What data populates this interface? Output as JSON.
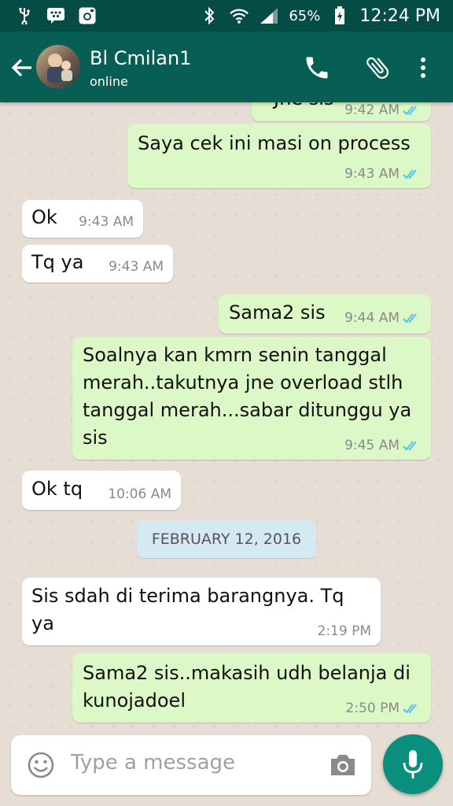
{
  "status_bar": {
    "battery": "65%",
    "time": "12:24 PM",
    "left_icons": [
      "usb-icon",
      "bbm-icon",
      "instagram-icon"
    ],
    "right_icons": [
      "bluetooth-icon",
      "wifi-icon",
      "signal-icon",
      "battery-icon"
    ]
  },
  "header": {
    "contact_name": "Bl Cmilan1",
    "status": "online",
    "icons": [
      "back-arrow-icon",
      "phone-icon",
      "paperclip-icon",
      "more-vert-icon"
    ]
  },
  "messages": [
    {
      "direction": "out",
      "text": "Jne sis",
      "time": "9:42 AM",
      "read": true
    },
    {
      "direction": "out",
      "text": "Saya cek ini masi on process",
      "time": "9:43 AM",
      "read": true
    },
    {
      "direction": "in",
      "text": "Ok",
      "time": "9:43 AM"
    },
    {
      "direction": "in",
      "text": "Tq ya",
      "time": "9:43 AM"
    },
    {
      "direction": "out",
      "text": "Sama2 sis",
      "time": "9:44 AM",
      "read": true
    },
    {
      "direction": "out",
      "text": "Soalnya kan kmrn senin tanggal merah..takutnya jne overload stlh tanggal merah...sabar ditunggu ya sis",
      "time": "9:45 AM",
      "read": true
    },
    {
      "direction": "in",
      "text": "Ok tq",
      "time": "10:06 AM"
    },
    {
      "direction": "in",
      "text": "Sis sdah di terima barangnya. Tq ya",
      "time": "2:19 PM"
    },
    {
      "direction": "out",
      "text": "Sama2 sis..makasih udh belanja di kunojadoel",
      "time": "2:50 PM",
      "read": true
    }
  ],
  "date_chip": "FEBRUARY 12, 2016",
  "composer": {
    "placeholder": "Type a message",
    "icons": [
      "emoji-icon",
      "camera-icon",
      "mic-icon"
    ]
  },
  "colors": {
    "header": "#075e54",
    "status_bar": "#054d44",
    "outgoing_bubble": "#dcf8c6",
    "incoming_bubble": "#ffffff",
    "read_tick": "#4fc3f7",
    "mic_button": "#0a8f7f"
  }
}
